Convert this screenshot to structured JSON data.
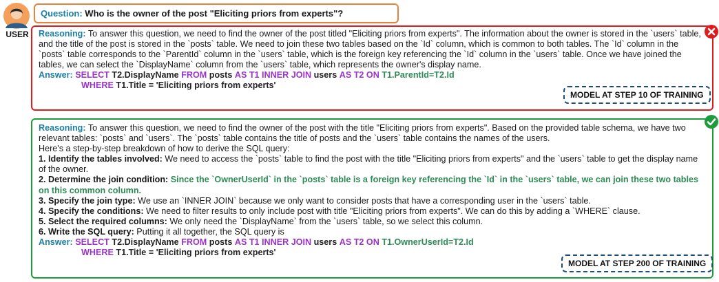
{
  "user": {
    "label": "USER"
  },
  "question": {
    "key": "Question:",
    "text": "Who is the owner of the post \"Eliciting priors from experts\"?"
  },
  "response1": {
    "reasoning_key": "Reasoning:",
    "reasoning_text": "To answer this question, we need to find the owner of the post titled \"Eliciting priors from experts\". The information about the owner is stored in the `users` table, and the title of the post is stored in the `posts` table. We need to join these two tables based on the `Id` column, which is common to both tables. The `Id` column in the `posts` table corresponds to the `ParentId` column in the `users` table, which is the foreign key referencing the `Id` column in the `users` table. Once we have joined the tables, we can select the `DisplayName` column from the `users` table, which represents the owner's display name.",
    "answer_key": "Answer:",
    "sql": {
      "select": "SELECT",
      "select_col": "T2.DisplayName",
      "from": "FROM",
      "table1": "posts",
      "as1": "AS T1 INNER JOIN",
      "table2": "users",
      "as2": "AS T2 ON",
      "join_cond": "T1.ParentId=T2.Id",
      "where": "WHERE",
      "where_cond": "T1.Title = 'Eliciting priors from experts'"
    },
    "badge": "MODEL AT STEP 10 OF TRAINING",
    "status": "incorrect",
    "status_color": "#e01b1b"
  },
  "response2": {
    "reasoning_key": "Reasoning:",
    "reasoning_intro": "To answer this question, we need to find the owner of the post with the title \"Eliciting priors from experts\". Based on the provided table schema, we have two relevant tables: `posts` and `users`. The `posts` table contains the title of posts and the `users` table contains the names of the users.",
    "breakdown": "Here's a step-by-step breakdown of how to derive the SQL query:",
    "steps": [
      {
        "head": "1. Identify the tables involved:",
        "text": " We need to access the `posts` table to find the post with the title \"Eliciting priors from experts\" and the `users` table to get the display name of the owner."
      },
      {
        "head": "2. Determine the join condition:",
        "text": " Since the `OwnerUserId` in the `posts` table is a foreign key referencing the `Id` in the `users` table, we can join these two tables on this common column."
      },
      {
        "head": "3. Specify the join type:",
        "text": " We use an `INNER JOIN` because we only want to consider posts that have a corresponding user in the `users` table."
      },
      {
        "head": "4. Specify the conditions:",
        "text": " We need to filter results to only include post with title \"Eliciting priors from experts\". We can do this by adding a `WHERE` clause."
      },
      {
        "head": "5. Select the required columns:",
        "text": " We only need the `DisplayName` from the `users` table, so we select this column."
      },
      {
        "head": "6. Write the SQL query:",
        "text": " Putting it all together, the SQL query is"
      }
    ],
    "answer_key": "Answer:",
    "sql": {
      "select": "SELECT",
      "select_col": "T2.DisplayName",
      "from": "FROM",
      "table1": "posts",
      "as1": "AS T1 INNER JOIN",
      "table2": "users",
      "as2": "AS T2 ON",
      "join_cond": "T1.OwnerUserId=T2.Id",
      "where": "WHERE",
      "where_cond": "T1.Title = 'Eliciting priors from experts'"
    },
    "badge": "MODEL AT STEP 200 OF TRAINING",
    "status": "correct",
    "status_color": "#1e9b3a"
  },
  "colors": {
    "question_border": "#e8823a",
    "keyword": "#1b7fa6",
    "sql_keyword": "#9b33c8",
    "sql_condition": "#2e8b57",
    "badge_border": "#1d4e7a"
  },
  "icons": {
    "avatar": "user-avatar-icon",
    "incorrect": "x-circle-icon",
    "correct": "check-circle-icon"
  }
}
